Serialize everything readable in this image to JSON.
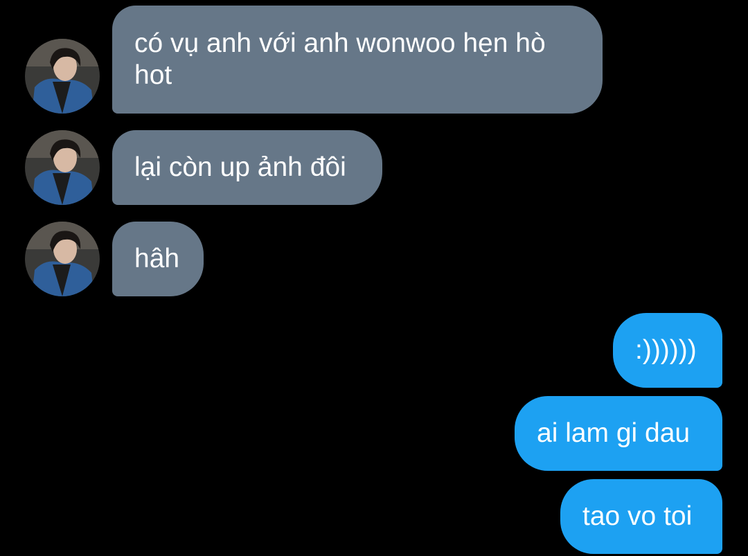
{
  "messages": [
    {
      "direction": "incoming",
      "text": "có vụ anh với anh wonwoo hẹn hò\nhot"
    },
    {
      "direction": "incoming",
      "text": "lại còn up ảnh đôi"
    },
    {
      "direction": "incoming",
      "text": "hâh"
    },
    {
      "direction": "outgoing",
      "text": ":))))))"
    },
    {
      "direction": "outgoing",
      "text": "ai lam gi dau"
    },
    {
      "direction": "outgoing",
      "text": "tao vo toi"
    }
  ],
  "colors": {
    "background": "#000000",
    "incoming_bubble": "#667788",
    "outgoing_bubble": "#1da1f2",
    "text": "#ffffff"
  },
  "icons": {
    "avatar": "contact-avatar-photo"
  }
}
